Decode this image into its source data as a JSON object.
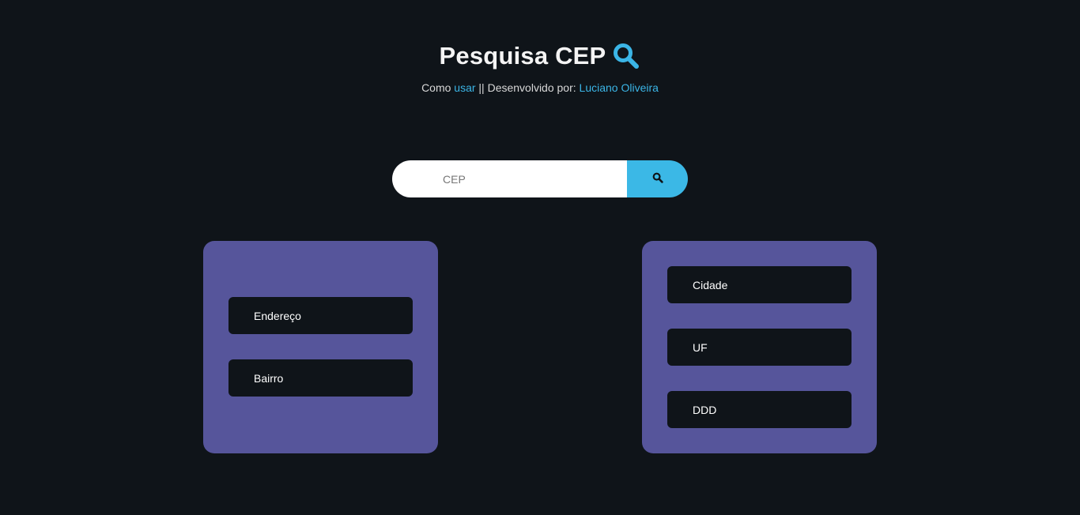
{
  "header": {
    "title": "Pesquisa CEP",
    "title_icon": "search-icon",
    "subtitle_prefix": "Como ",
    "subtitle_link_usar": "usar",
    "subtitle_middle": " || Desenvolvido por: ",
    "subtitle_link_author": "Luciano Oliveira"
  },
  "search": {
    "placeholder": "CEP",
    "value": "",
    "button_icon": "search-icon"
  },
  "cards": {
    "left": {
      "fields": [
        "Endereço",
        "Bairro"
      ]
    },
    "right": {
      "fields": [
        "Cidade",
        "UF",
        "DDD"
      ]
    }
  },
  "colors": {
    "background": "#0f1419",
    "accent": "#3bb8e6",
    "card": "#56559b",
    "field": "#0f1419"
  }
}
